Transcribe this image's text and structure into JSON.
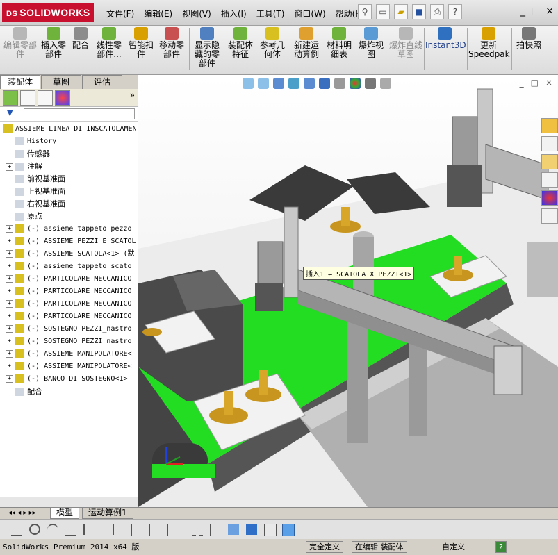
{
  "app": {
    "logo_ds": "DS",
    "logo_text": "SOLIDWORKS"
  },
  "menu": [
    "文件(F)",
    "编辑(E)",
    "视图(V)",
    "插入(I)",
    "工具(T)",
    "窗口(W)",
    "帮助(H)"
  ],
  "window_controls": [
    "_",
    "□",
    "×"
  ],
  "ribbon": [
    {
      "label": "编辑零部件",
      "disabled": true
    },
    {
      "label": "插入零部件",
      "disabled": false
    },
    {
      "label": "配合",
      "disabled": false
    },
    {
      "label": "线性零部件...",
      "disabled": false
    },
    {
      "label": "智能扣件",
      "disabled": false
    },
    {
      "label": "移动零部件",
      "disabled": false
    },
    {
      "label": "显示隐藏的零部件",
      "disabled": false
    },
    {
      "label": "装配体特征",
      "disabled": false
    },
    {
      "label": "参考几何体",
      "disabled": false
    },
    {
      "label": "新建运动算例",
      "disabled": false
    },
    {
      "label": "材料明细表",
      "disabled": false
    },
    {
      "label": "爆炸视图",
      "disabled": false
    },
    {
      "label": "爆炸直线草图",
      "disabled": true
    },
    {
      "label": "Instant3D",
      "disabled": false
    },
    {
      "label": "更新Speedpak",
      "disabled": false
    },
    {
      "label": "拍快照",
      "disabled": false
    }
  ],
  "panel_tabs": [
    "装配体",
    "草图",
    "评估"
  ],
  "tree": {
    "root": "ASSIEME LINEA DI INSCATOLAMEN",
    "items": [
      {
        "label": "History",
        "mono": true,
        "expand": false
      },
      {
        "label": "传感器",
        "mono": false,
        "expand": false
      },
      {
        "label": "注解",
        "mono": false,
        "expand": true
      },
      {
        "label": "前视基准面",
        "mono": false,
        "expand": false
      },
      {
        "label": "上视基准面",
        "mono": false,
        "expand": false
      },
      {
        "label": "右视基准面",
        "mono": false,
        "expand": false
      },
      {
        "label": "原点",
        "mono": false,
        "expand": false
      },
      {
        "label": "(-) assieme tappeto pezzo",
        "mono": true,
        "expand": true
      },
      {
        "label": "(-) ASSIEME PEZZI E SCATOL",
        "mono": true,
        "expand": true
      },
      {
        "label": "(-) ASSIEME SCATOLA<1> (默",
        "mono": true,
        "expand": true
      },
      {
        "label": "(-) assieme tappeto scato",
        "mono": true,
        "expand": true
      },
      {
        "label": "(-) PARTICOLARE MECCANICO",
        "mono": true,
        "expand": true
      },
      {
        "label": "(-) PARTICOLARE MECCANICO",
        "mono": true,
        "expand": true
      },
      {
        "label": "(-) PARTICOLARE MECCANICO",
        "mono": true,
        "expand": true
      },
      {
        "label": "(-) PARTICOLARE MECCANICO",
        "mono": true,
        "expand": true
      },
      {
        "label": "(-) SOSTEGNO PEZZI_nastro",
        "mono": true,
        "expand": true
      },
      {
        "label": "(-) SOSTEGNO PEZZI_nastro",
        "mono": true,
        "expand": true
      },
      {
        "label": "(-) ASSIEME MANIPOLATORE<",
        "mono": true,
        "expand": true
      },
      {
        "label": "(-) ASSIEME MANIPOLATORE<",
        "mono": true,
        "expand": true
      },
      {
        "label": "(-) BANCO DI SOSTEGNO<1>",
        "mono": true,
        "expand": true
      },
      {
        "label": "配合",
        "mono": false,
        "expand": false
      }
    ]
  },
  "tooltip": "插入1 ← SCATOLA X PEZZI<1>",
  "bottom_tabs": [
    "模型",
    "运动算例1"
  ],
  "status": {
    "version": "SolidWorks Premium 2014 x64 版",
    "definition": "完全定义",
    "mode": "在编辑 装配体",
    "custom": "自定义",
    "help": "?"
  }
}
